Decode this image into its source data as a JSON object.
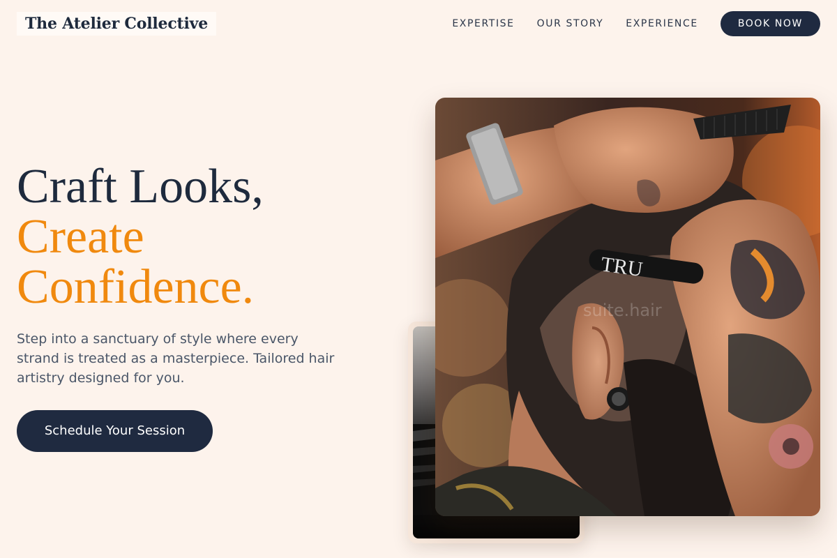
{
  "header": {
    "logo": "The Atelier Collective",
    "nav": [
      {
        "label": "EXPERTISE"
      },
      {
        "label": "OUR STORY"
      },
      {
        "label": "EXPERIENCE"
      }
    ],
    "cta": "BOOK NOW"
  },
  "hero": {
    "title_line1": "Craft Looks,",
    "title_line2": "Create",
    "title_line3": "Confidence.",
    "subtitle": "Step into a sanctuary of style where every strand is treated as a masterpiece. Tailored hair artistry designed for you.",
    "button": "Schedule Your Session"
  },
  "photo": {
    "razor_text": "TRU",
    "watermark": "suite.hair"
  },
  "colors": {
    "background": "#fdf3ec",
    "navy": "#1f2a40",
    "accent": "#f0890e"
  }
}
